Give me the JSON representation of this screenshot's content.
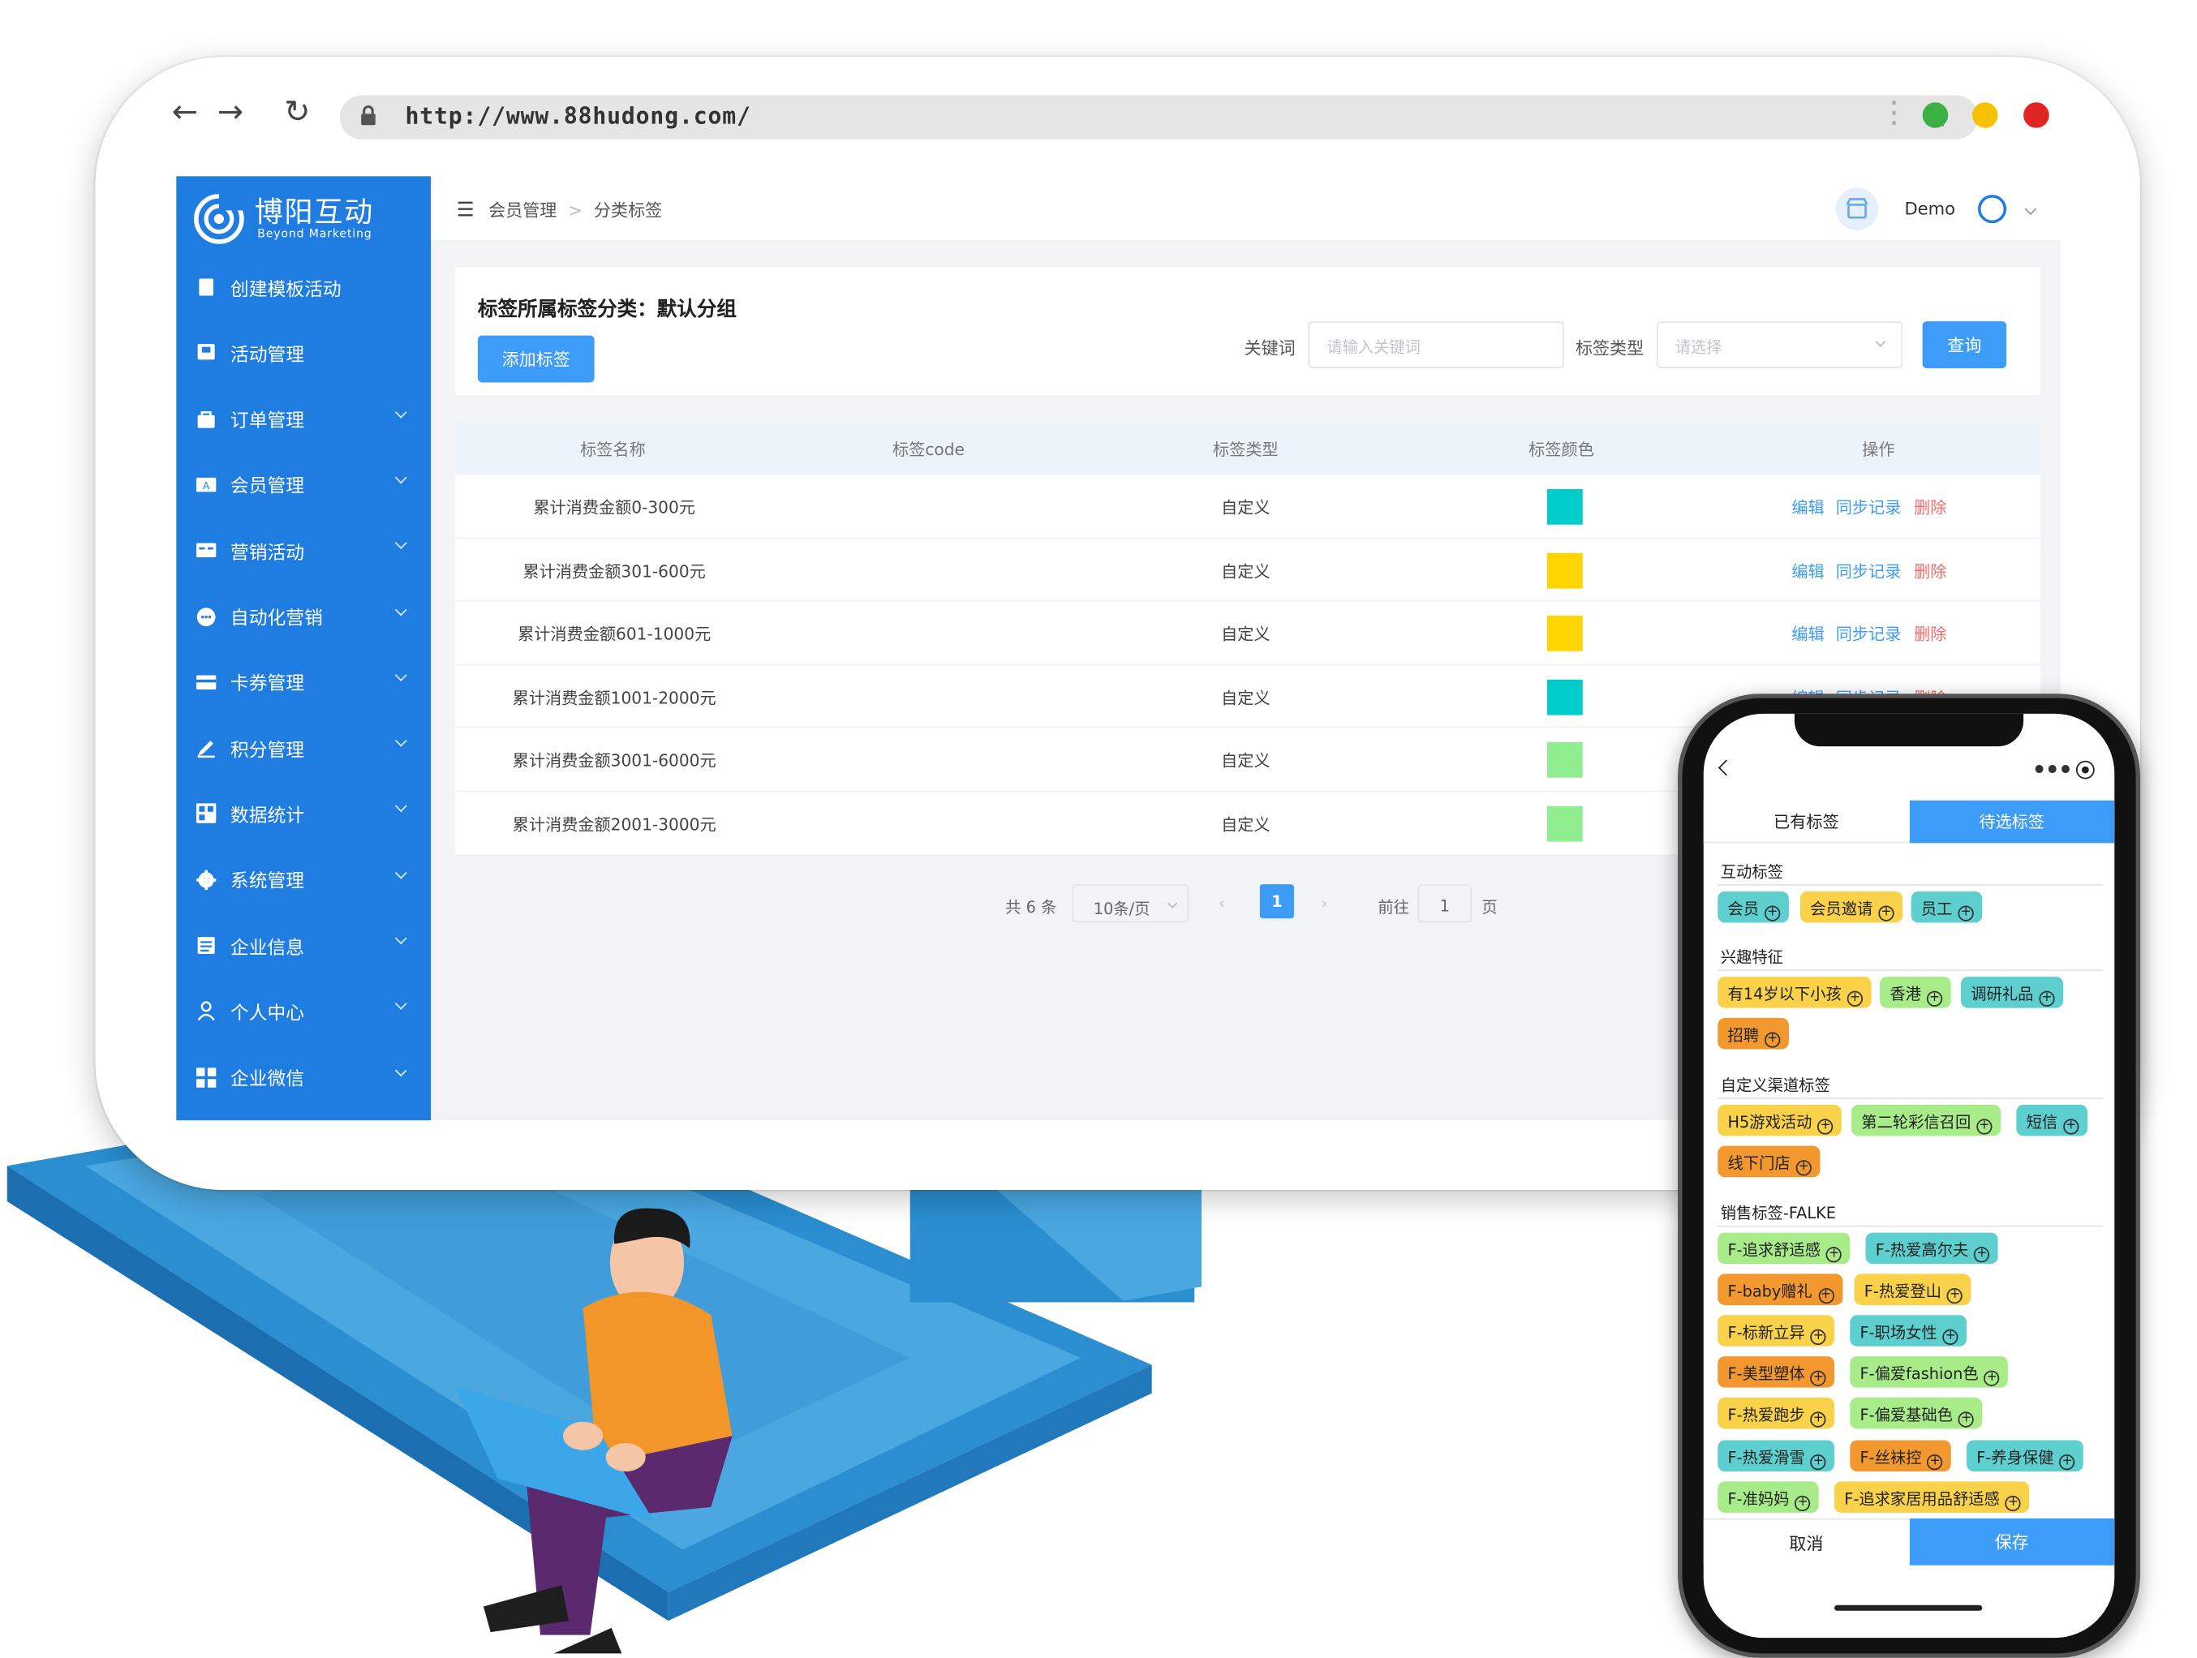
{
  "browser": {
    "url": "http://www.88hudong.com/",
    "window_dots": [
      "#3cb043",
      "#f7c200",
      "#e02424"
    ]
  },
  "app": {
    "logo": {
      "brand": "博阳互动",
      "sub": "Beyond  Marketing"
    },
    "sidebar": {
      "items": [
        {
          "label": "创建模板活动",
          "icon": "file-icon",
          "has_arrow": false
        },
        {
          "label": "活动管理",
          "icon": "flag-icon",
          "has_arrow": false
        },
        {
          "label": "订单管理",
          "icon": "bag-icon",
          "has_arrow": true
        },
        {
          "label": "会员管理",
          "icon": "id-card-icon",
          "has_arrow": true
        },
        {
          "label": "营销活动",
          "icon": "ticket-icon",
          "has_arrow": true
        },
        {
          "label": "自动化营销",
          "icon": "chat-icon",
          "has_arrow": true
        },
        {
          "label": "卡券管理",
          "icon": "card-icon",
          "has_arrow": true
        },
        {
          "label": "积分管理",
          "icon": "pen-icon",
          "has_arrow": true
        },
        {
          "label": "数据统计",
          "icon": "grid-icon",
          "has_arrow": true
        },
        {
          "label": "系统管理",
          "icon": "gear-icon",
          "has_arrow": true
        },
        {
          "label": "企业信息",
          "icon": "list-icon",
          "has_arrow": true
        },
        {
          "label": "个人中心",
          "icon": "person-icon",
          "has_arrow": true
        },
        {
          "label": "企业微信",
          "icon": "apps-icon",
          "has_arrow": true
        }
      ]
    },
    "breadcrumb": [
      "会员管理",
      "分类标签"
    ],
    "user": {
      "name": "Demo"
    },
    "header": {
      "title": "标签所属标签分类：默认分组",
      "add_button": "添加标签",
      "keyword_label": "关键词",
      "keyword_placeholder": "请输入关键词",
      "type_label": "标签类型",
      "type_placeholder": "请选择",
      "query_button": "查询"
    },
    "table": {
      "columns": [
        "标签名称",
        "标签code",
        "标签类型",
        "标签颜色",
        "操作"
      ],
      "rows": [
        {
          "name": "累计消费金额0-300元",
          "code": "",
          "type": "自定义",
          "color": "#00cccc"
        },
        {
          "name": "累计消费金额301-600元",
          "code": "",
          "type": "自定义",
          "color": "#ffd500"
        },
        {
          "name": "累计消费金额601-1000元",
          "code": "",
          "type": "自定义",
          "color": "#ffd500"
        },
        {
          "name": "累计消费金额1001-2000元",
          "code": "",
          "type": "自定义",
          "color": "#00cccc"
        },
        {
          "name": "累计消费金额3001-6000元",
          "code": "",
          "type": "自定义",
          "color": "#90ee90"
        },
        {
          "name": "累计消费金额2001-3000元",
          "code": "",
          "type": "自定义",
          "color": "#90ee90"
        }
      ],
      "actions": {
        "edit": "编辑",
        "sync": "同步记录",
        "delete": "删除"
      }
    },
    "pagination": {
      "total": "共 6 条",
      "page_size": "10条/页",
      "current": "1",
      "goto_prefix": "前往",
      "goto_value": "1",
      "goto_suffix": "页"
    }
  },
  "phone": {
    "tabs": [
      "已有标签",
      "待选标签"
    ],
    "active_tab": 1,
    "sections": [
      {
        "title": "互动标签",
        "tags": [
          {
            "label": "会员",
            "color": "#5ecfcf"
          },
          {
            "label": "会员邀请",
            "color": "#f9d24a"
          },
          {
            "label": "员工",
            "color": "#5ecfcf"
          }
        ]
      },
      {
        "title": "兴趣特征",
        "tags": [
          {
            "label": "有14岁以下小孩",
            "color": "#f9d24a"
          },
          {
            "label": "香港",
            "color": "#a8ec8a"
          },
          {
            "label": "调研礼品",
            "color": "#5ecfcf"
          },
          {
            "label": "招聘",
            "color": "#f3982f"
          }
        ]
      },
      {
        "title": "自定义渠道标签",
        "tags": [
          {
            "label": "H5游戏活动",
            "color": "#f9d24a"
          },
          {
            "label": "第二轮彩信召回",
            "color": "#a8ec8a"
          },
          {
            "label": "短信",
            "color": "#5ecfcf"
          },
          {
            "label": "线下门店",
            "color": "#f3982f"
          }
        ]
      },
      {
        "title": "销售标签-FALKE",
        "tags": [
          {
            "label": "F-追求舒适感",
            "color": "#a8ec8a"
          },
          {
            "label": "F-热爱高尔夫",
            "color": "#5ecfcf"
          },
          {
            "label": "F-baby赠礼",
            "color": "#f3982f"
          },
          {
            "label": "F-热爱登山",
            "color": "#f9d24a"
          },
          {
            "label": "F-标新立异",
            "color": "#f9d24a"
          },
          {
            "label": "F-职场女性",
            "color": "#5ecfcf"
          },
          {
            "label": "F-美型塑体",
            "color": "#f3982f"
          },
          {
            "label": "F-偏爱fashion色",
            "color": "#a8ec8a"
          },
          {
            "label": "F-热爱跑步",
            "color": "#f9d24a"
          },
          {
            "label": "F-偏爱基础色",
            "color": "#a8ec8a"
          },
          {
            "label": "F-热爱滑雪",
            "color": "#5ecfcf"
          },
          {
            "label": "F-丝袜控",
            "color": "#f3982f"
          },
          {
            "label": "F-养身保健",
            "color": "#5ecfcf"
          },
          {
            "label": "F-准妈妈",
            "color": "#a8ec8a"
          },
          {
            "label": "F-追求家居用品舒适感",
            "color": "#f9d24a"
          }
        ]
      }
    ],
    "cancel": "取消",
    "save": "保存"
  },
  "theme": {
    "primary": "#1f7ce0",
    "accent": "#3c9cf7",
    "danger": "#f56c6c"
  }
}
